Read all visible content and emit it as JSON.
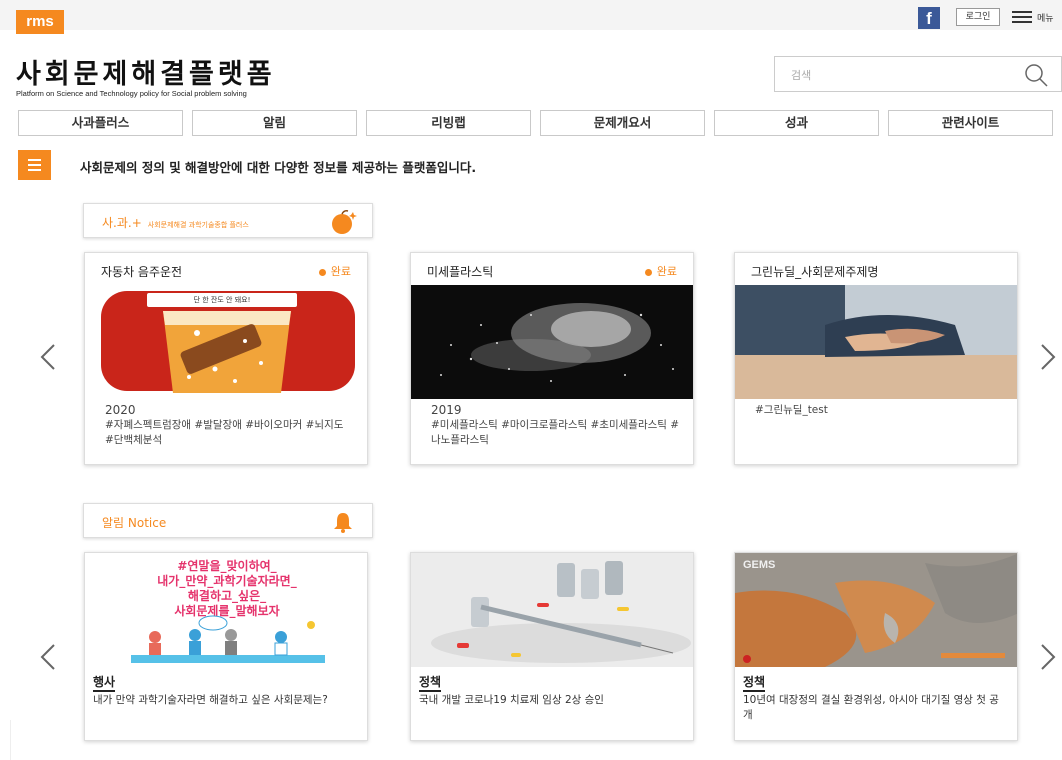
{
  "header": {
    "logo_text": "rms",
    "facebook_label": "f",
    "login_label": "로그인",
    "menu_label": "메뉴"
  },
  "site": {
    "title": "사회문제해결플랫폼",
    "subtitle": "Platform on Science and Technology policy for Social problem solving"
  },
  "search": {
    "placeholder": "검색"
  },
  "nav": [
    {
      "label": "사과플러스"
    },
    {
      "label": "알림"
    },
    {
      "label": "리빙랩"
    },
    {
      "label": "문제개요서"
    },
    {
      "label": "성과"
    },
    {
      "label": "관련사이트"
    }
  ],
  "intro_text": "사회문제의 정의 및 해결방안에 대한 다양한 정보를 제공하는 플랫폼입니다.",
  "sections": {
    "sagwa": {
      "label": "사.과.+",
      "sublabel": "사회문제해결 과학기술종합 플러스"
    },
    "notice": {
      "label": "알림 Notice"
    }
  },
  "sagwa_cards": [
    {
      "title": "자동차 음주운전",
      "status": "완료",
      "year": "2020",
      "tags": "#자폐스펙트럼장애 #발달장애 #바이오마커 #뇌지도 #단백체분석",
      "banner": "단 한 잔도 안 돼요!"
    },
    {
      "title": "미세플라스틱",
      "status": "완료",
      "year": "2019",
      "tags": "#미세플라스틱 #마이크로플라스틱 #초미세플라스틱 #나노플라스틱"
    },
    {
      "title": "그린뉴딜_사회문제주제명",
      "status": "",
      "year": "",
      "tags": "#그린뉴딜_test"
    }
  ],
  "notice_cards": [
    {
      "category": "행사",
      "desc": "내가 만약 과학기술자라면 해결하고 싶은 사회문제는?",
      "poster_lines": [
        "#연말을_맞이하여_",
        "내가_만약_과학기술자라면_",
        "해결하고_싶은_",
        "사회문제를_말해보자"
      ]
    },
    {
      "category": "정책",
      "desc": "국내 개발 코로나19 치료제 임상 2상 승인"
    },
    {
      "category": "정책",
      "desc": "10년여 대장정의 결실 환경위성, 아시아 대기질 영상 첫 공개",
      "map_label": "GEMS"
    }
  ],
  "colors": {
    "accent": "#f5891f",
    "facebook": "#3b5998"
  }
}
